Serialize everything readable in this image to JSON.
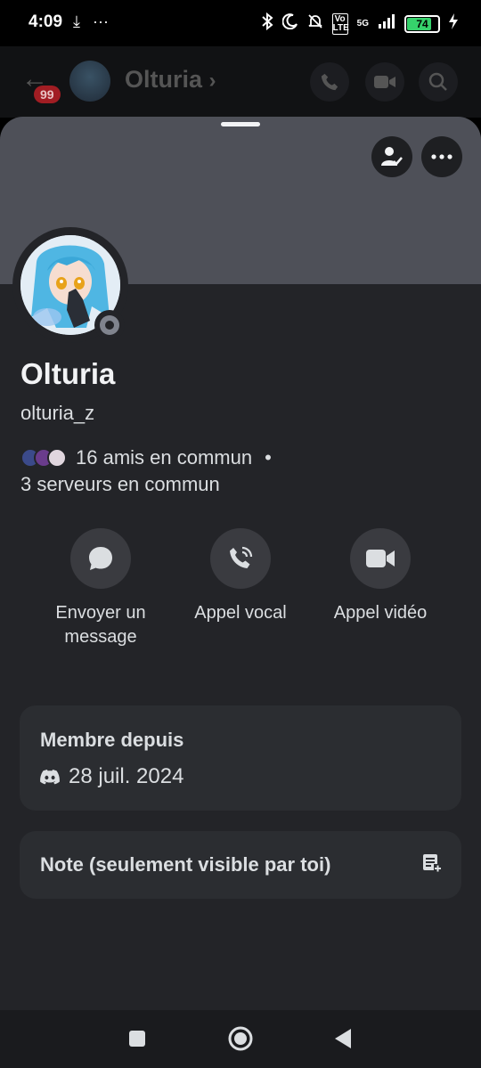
{
  "status_bar": {
    "time": "4:09",
    "battery": "74",
    "network": "5G",
    "volte": "Vo LTE"
  },
  "app_bar": {
    "badge": "99",
    "name": "Olturia",
    "chevron": "›"
  },
  "profile": {
    "display_name": "Olturia",
    "username": "olturia_z",
    "mutual_friends": "16 amis en commun",
    "separator": "•",
    "mutual_servers": "3 serveurs en commun"
  },
  "actions": [
    {
      "label": "Envoyer un message",
      "icon": "chat-bubble-icon"
    },
    {
      "label": "Appel vocal",
      "icon": "phone-call-icon"
    },
    {
      "label": "Appel vidéo",
      "icon": "video-camera-icon"
    }
  ],
  "member_since": {
    "title": "Membre depuis",
    "date": "28 juil. 2024"
  },
  "note": {
    "title": "Note (seulement visible par toi)"
  },
  "colors": {
    "sheet_bg": "#232428",
    "banner": "#4e5058",
    "card_bg": "#2b2d31",
    "badge": "#a11d23",
    "battery": "#36d26b"
  }
}
